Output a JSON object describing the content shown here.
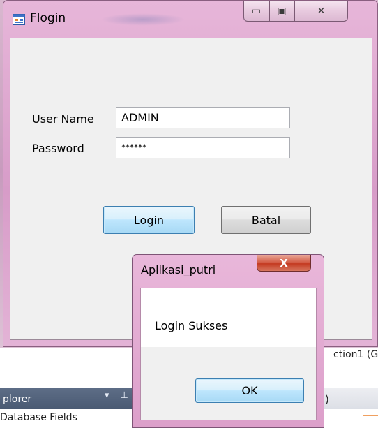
{
  "background": {
    "tab_fragment": "ction1 (G",
    "explorer_title": "plorer",
    "explorer_icons": "▾ ⊥",
    "right_tab_fragment": ")",
    "database_fields": "Database Fields"
  },
  "window": {
    "title": "Flogin",
    "icon": "form-icon",
    "caption_buttons": {
      "minimize": "▭",
      "maximize": "▣",
      "close": "✕"
    }
  },
  "form": {
    "username_label": "User Name",
    "username_value": "ADMIN",
    "password_label": "Password",
    "password_value": "******",
    "login_button": "Login",
    "cancel_button": "Batal"
  },
  "dialog": {
    "title": "Aplikasi_putri",
    "close_glyph": "X",
    "message": "Login Sukses",
    "ok_button": "OK"
  },
  "colors": {
    "window_frame": "#dba3cc",
    "client_bg": "#f0f0f0",
    "focus_button": "#3c7fb1",
    "close_button": "#c43a21"
  }
}
